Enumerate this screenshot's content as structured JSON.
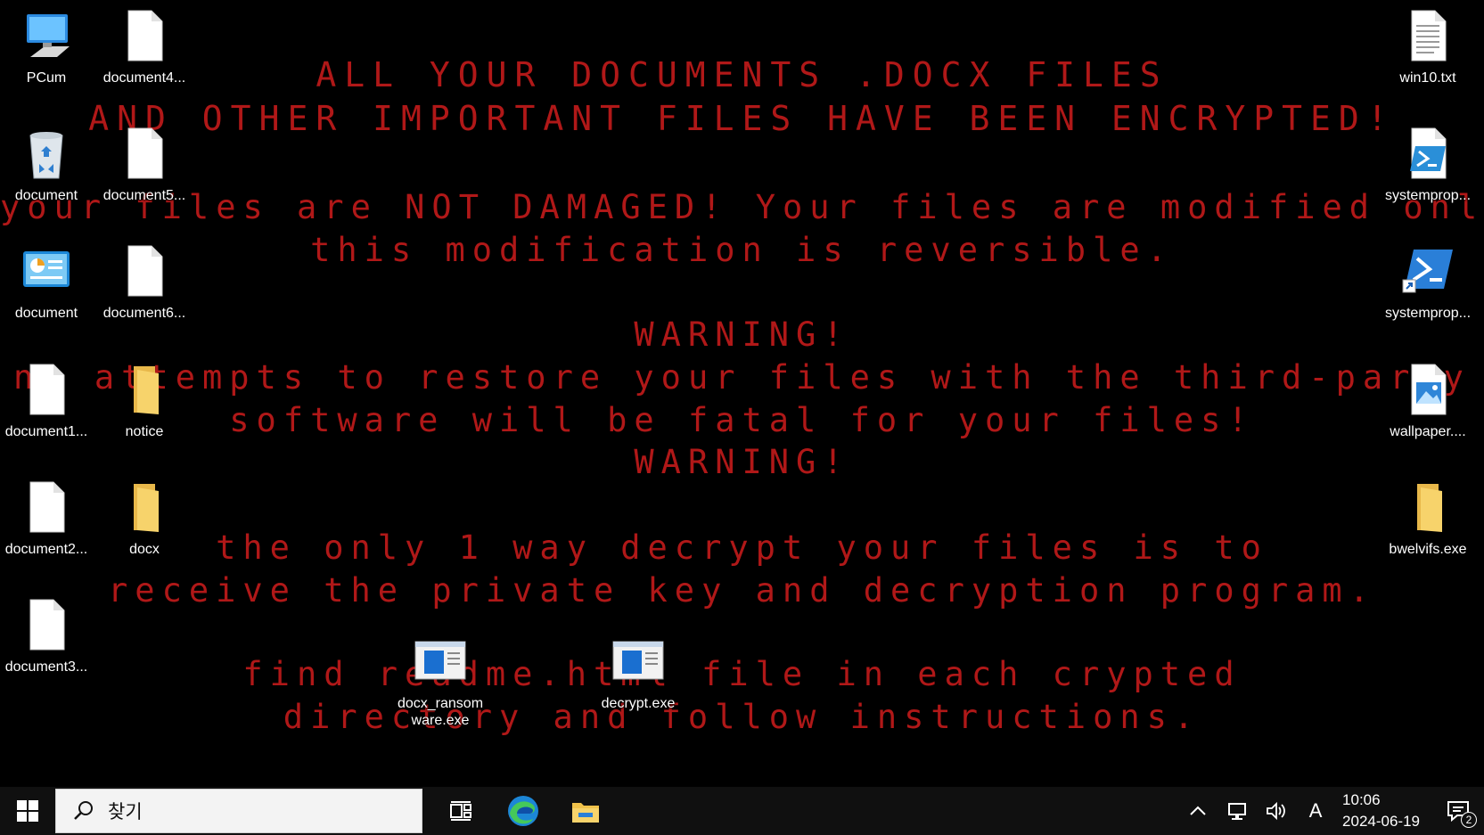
{
  "wallpaper": {
    "lines": [
      "ALL YOUR DOCUMENTS .DOCX FILES",
      "AND OTHER IMPORTANT FILES HAVE BEEN ENCRYPTED!",
      "your files are NOT DAMAGED! Your files are modified only.",
      "this modification is reversible.",
      "WARNING!",
      "ny attempts to restore your files with the third-party",
      "software will be fatal for your files!",
      "WARNING!",
      "the only 1 way decrypt your files is to",
      "receive the private key and decryption program.",
      "find readme.html file in each crypted",
      "directory and follow instructions."
    ],
    "color": "#b01818"
  },
  "desktop": {
    "left_col1": [
      {
        "label": "PCum",
        "icon": "computer-icon"
      },
      {
        "label": "document",
        "icon": "recycle-bin-icon"
      },
      {
        "label": "document",
        "icon": "control-panel-icon"
      },
      {
        "label": "document1...",
        "icon": "file-icon"
      },
      {
        "label": "document2...",
        "icon": "file-icon"
      },
      {
        "label": "document3...",
        "icon": "file-icon"
      }
    ],
    "left_col2": [
      {
        "label": "document4...",
        "icon": "file-icon"
      },
      {
        "label": "document5...",
        "icon": "file-icon"
      },
      {
        "label": "document6...",
        "icon": "file-icon"
      },
      {
        "label": "notice",
        "icon": "folder-icon"
      },
      {
        "label": "docx",
        "icon": "folder-icon"
      }
    ],
    "right_col": [
      {
        "label": "win10.txt",
        "icon": "text-file-icon"
      },
      {
        "label": "systemprop...",
        "icon": "powershell-script-icon"
      },
      {
        "label": "systemprop...",
        "icon": "powershell-shortcut-icon"
      },
      {
        "label": "wallpaper....",
        "icon": "image-file-icon"
      },
      {
        "label": "bwelvifs.exe",
        "icon": "folder-icon"
      }
    ],
    "middle": [
      {
        "label": "docx_ransomware.exe",
        "label_line1": "docx_ransom",
        "label_line2": "ware.exe",
        "icon": "exe-app-icon"
      },
      {
        "label": "decrypt.exe",
        "icon": "exe-app-icon"
      }
    ]
  },
  "taskbar": {
    "search_placeholder": "찾기",
    "clock_time": "10:06",
    "clock_date": "2024-06-19",
    "ime_indicator": "A",
    "notification_count": "2"
  }
}
